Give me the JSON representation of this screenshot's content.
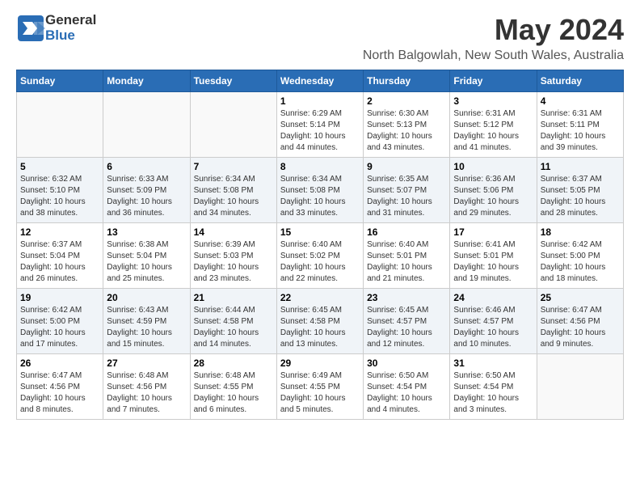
{
  "header": {
    "logo_general": "General",
    "logo_blue": "Blue",
    "month_year": "May 2024",
    "location": "North Balgowlah, New South Wales, Australia"
  },
  "weekdays": [
    "Sunday",
    "Monday",
    "Tuesday",
    "Wednesday",
    "Thursday",
    "Friday",
    "Saturday"
  ],
  "weeks": [
    [
      {
        "day": "",
        "info": ""
      },
      {
        "day": "",
        "info": ""
      },
      {
        "day": "",
        "info": ""
      },
      {
        "day": "1",
        "info": "Sunrise: 6:29 AM\nSunset: 5:14 PM\nDaylight: 10 hours\nand 44 minutes."
      },
      {
        "day": "2",
        "info": "Sunrise: 6:30 AM\nSunset: 5:13 PM\nDaylight: 10 hours\nand 43 minutes."
      },
      {
        "day": "3",
        "info": "Sunrise: 6:31 AM\nSunset: 5:12 PM\nDaylight: 10 hours\nand 41 minutes."
      },
      {
        "day": "4",
        "info": "Sunrise: 6:31 AM\nSunset: 5:11 PM\nDaylight: 10 hours\nand 39 minutes."
      }
    ],
    [
      {
        "day": "5",
        "info": "Sunrise: 6:32 AM\nSunset: 5:10 PM\nDaylight: 10 hours\nand 38 minutes."
      },
      {
        "day": "6",
        "info": "Sunrise: 6:33 AM\nSunset: 5:09 PM\nDaylight: 10 hours\nand 36 minutes."
      },
      {
        "day": "7",
        "info": "Sunrise: 6:34 AM\nSunset: 5:08 PM\nDaylight: 10 hours\nand 34 minutes."
      },
      {
        "day": "8",
        "info": "Sunrise: 6:34 AM\nSunset: 5:08 PM\nDaylight: 10 hours\nand 33 minutes."
      },
      {
        "day": "9",
        "info": "Sunrise: 6:35 AM\nSunset: 5:07 PM\nDaylight: 10 hours\nand 31 minutes."
      },
      {
        "day": "10",
        "info": "Sunrise: 6:36 AM\nSunset: 5:06 PM\nDaylight: 10 hours\nand 29 minutes."
      },
      {
        "day": "11",
        "info": "Sunrise: 6:37 AM\nSunset: 5:05 PM\nDaylight: 10 hours\nand 28 minutes."
      }
    ],
    [
      {
        "day": "12",
        "info": "Sunrise: 6:37 AM\nSunset: 5:04 PM\nDaylight: 10 hours\nand 26 minutes."
      },
      {
        "day": "13",
        "info": "Sunrise: 6:38 AM\nSunset: 5:04 PM\nDaylight: 10 hours\nand 25 minutes."
      },
      {
        "day": "14",
        "info": "Sunrise: 6:39 AM\nSunset: 5:03 PM\nDaylight: 10 hours\nand 23 minutes."
      },
      {
        "day": "15",
        "info": "Sunrise: 6:40 AM\nSunset: 5:02 PM\nDaylight: 10 hours\nand 22 minutes."
      },
      {
        "day": "16",
        "info": "Sunrise: 6:40 AM\nSunset: 5:01 PM\nDaylight: 10 hours\nand 21 minutes."
      },
      {
        "day": "17",
        "info": "Sunrise: 6:41 AM\nSunset: 5:01 PM\nDaylight: 10 hours\nand 19 minutes."
      },
      {
        "day": "18",
        "info": "Sunrise: 6:42 AM\nSunset: 5:00 PM\nDaylight: 10 hours\nand 18 minutes."
      }
    ],
    [
      {
        "day": "19",
        "info": "Sunrise: 6:42 AM\nSunset: 5:00 PM\nDaylight: 10 hours\nand 17 minutes."
      },
      {
        "day": "20",
        "info": "Sunrise: 6:43 AM\nSunset: 4:59 PM\nDaylight: 10 hours\nand 15 minutes."
      },
      {
        "day": "21",
        "info": "Sunrise: 6:44 AM\nSunset: 4:58 PM\nDaylight: 10 hours\nand 14 minutes."
      },
      {
        "day": "22",
        "info": "Sunrise: 6:45 AM\nSunset: 4:58 PM\nDaylight: 10 hours\nand 13 minutes."
      },
      {
        "day": "23",
        "info": "Sunrise: 6:45 AM\nSunset: 4:57 PM\nDaylight: 10 hours\nand 12 minutes."
      },
      {
        "day": "24",
        "info": "Sunrise: 6:46 AM\nSunset: 4:57 PM\nDaylight: 10 hours\nand 10 minutes."
      },
      {
        "day": "25",
        "info": "Sunrise: 6:47 AM\nSunset: 4:56 PM\nDaylight: 10 hours\nand 9 minutes."
      }
    ],
    [
      {
        "day": "26",
        "info": "Sunrise: 6:47 AM\nSunset: 4:56 PM\nDaylight: 10 hours\nand 8 minutes."
      },
      {
        "day": "27",
        "info": "Sunrise: 6:48 AM\nSunset: 4:56 PM\nDaylight: 10 hours\nand 7 minutes."
      },
      {
        "day": "28",
        "info": "Sunrise: 6:48 AM\nSunset: 4:55 PM\nDaylight: 10 hours\nand 6 minutes."
      },
      {
        "day": "29",
        "info": "Sunrise: 6:49 AM\nSunset: 4:55 PM\nDaylight: 10 hours\nand 5 minutes."
      },
      {
        "day": "30",
        "info": "Sunrise: 6:50 AM\nSunset: 4:54 PM\nDaylight: 10 hours\nand 4 minutes."
      },
      {
        "day": "31",
        "info": "Sunrise: 6:50 AM\nSunset: 4:54 PM\nDaylight: 10 hours\nand 3 minutes."
      },
      {
        "day": "",
        "info": ""
      }
    ]
  ]
}
